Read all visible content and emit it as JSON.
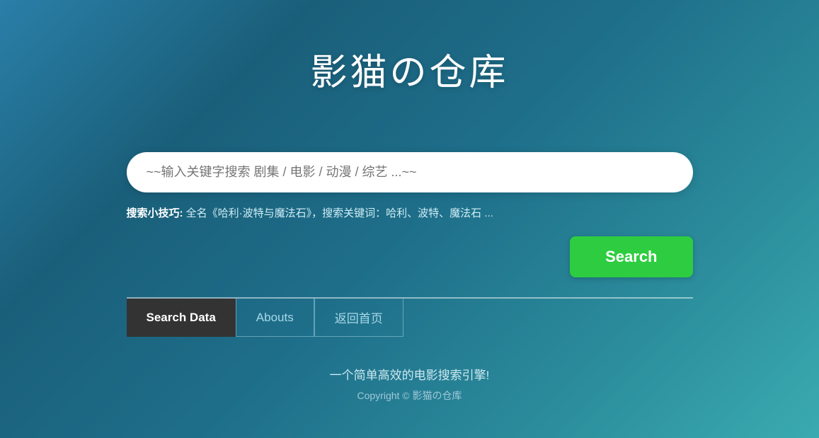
{
  "header": {
    "title": "影猫の仓库"
  },
  "search": {
    "placeholder": "~~输入关键字搜索 剧集 / 电影 / 动漫 / 综艺 ...~~",
    "tip_label": "搜索小技巧:",
    "tip_text": "全名《哈利·波特与魔法石》，搜索关键词：哈利、波特、魔法石 ...",
    "button_label": "Search"
  },
  "tabs": [
    {
      "label": "Search Data",
      "active": true
    },
    {
      "label": "Abouts",
      "active": false
    },
    {
      "label": "返回首页",
      "active": false
    }
  ],
  "footer": {
    "tagline": "一个简单高效的电影搜索引擎!",
    "copyright": "Copyright © 影猫の仓库"
  }
}
